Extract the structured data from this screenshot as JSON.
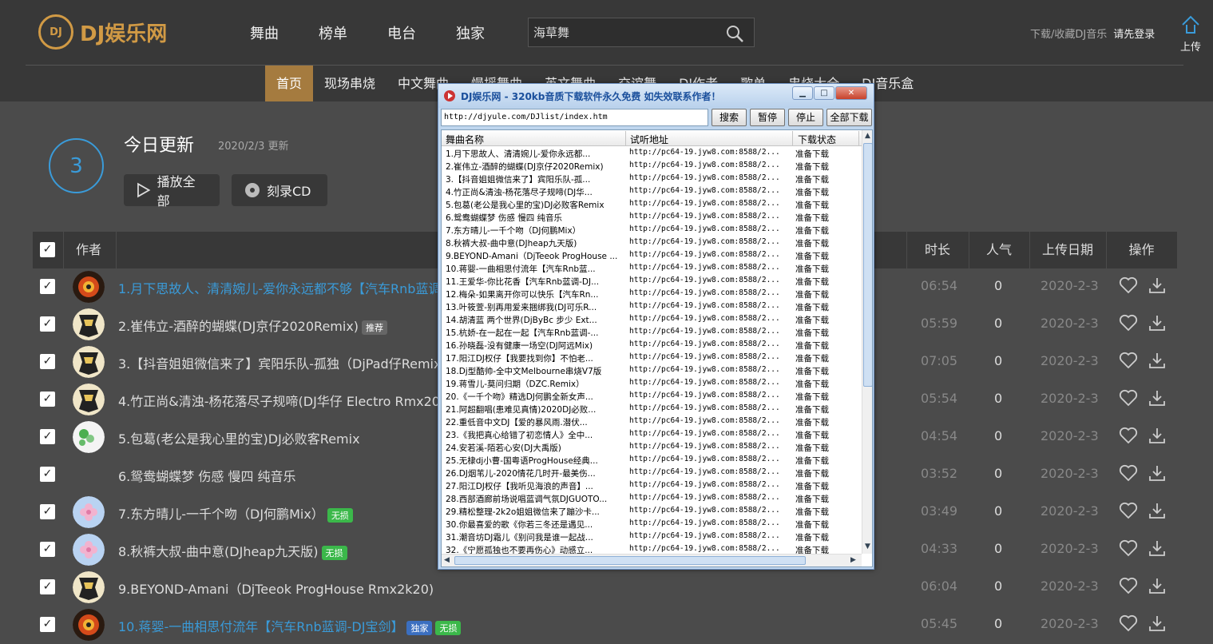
{
  "brand": {
    "logo_mark": "DJ",
    "name": "DJ娱乐网"
  },
  "nav": [
    "舞曲",
    "榜单",
    "电台",
    "独家"
  ],
  "search": {
    "value": "海草舞"
  },
  "top_right": {
    "download_text": "下载/收藏DJ音乐",
    "login": "请先登录",
    "upload": "上传"
  },
  "subnav": [
    "首页",
    "现场串烧",
    "中文舞曲",
    "慢摇舞曲",
    "英文舞曲",
    "交谊舞",
    "DJ作者",
    "歌单",
    "串烧大全",
    "DJ音乐盒"
  ],
  "today": {
    "count": "3",
    "title": "今日更新",
    "date": "2020/2/3 更新",
    "play_all": "播放全部",
    "burn_cd": "刻录CD"
  },
  "table": {
    "headers": {
      "author": "作者",
      "duration": "时长",
      "popularity": "人气",
      "upload_date": "上传日期",
      "action": "操作"
    },
    "rows": [
      {
        "title": "1.月下思故人、清清婉儿-爱你永远都不够【汽车Rnb蓝调",
        "badges": [],
        "duration": "06:54",
        "popularity": "0",
        "date": "2020-2-3",
        "highlight": true,
        "avatar": "fire"
      },
      {
        "title": "2.崔伟立-酒醉的蝴蝶(DJ京仔2020Remix)",
        "badges": [
          {
            "label": "推荐",
            "kind": "rec"
          }
        ],
        "duration": "05:59",
        "popularity": "0",
        "date": "2020-2-3",
        "highlight": false,
        "avatar": "robot"
      },
      {
        "title": "3.【抖音姐姐微信来了】宾阳乐队-孤独（DjPad仔Remix",
        "badges": [],
        "duration": "07:05",
        "popularity": "0",
        "date": "2020-2-3",
        "highlight": false,
        "avatar": "robot"
      },
      {
        "title": "4.竹正尚&清浊-杨花落尽子规啼(DJ华仔 Electro Rmx20",
        "badges": [],
        "duration": "05:54",
        "popularity": "0",
        "date": "2020-2-3",
        "highlight": false,
        "avatar": "robot"
      },
      {
        "title": "5.包葛(老公是我心里的宝)DJ必败客Remix",
        "badges": [],
        "duration": "04:54",
        "popularity": "0",
        "date": "2020-2-3",
        "highlight": false,
        "avatar": "green"
      },
      {
        "title": "6.鸳鸯蝴蝶梦 伤感 慢四 纯音乐",
        "badges": [],
        "duration": "03:52",
        "popularity": "0",
        "date": "2020-2-3",
        "highlight": false,
        "avatar": "none"
      },
      {
        "title": "7.东方晴儿-一千个吻（DJ何鹏Mix）",
        "badges": [
          {
            "label": "无损",
            "kind": "lossless"
          }
        ],
        "duration": "03:49",
        "popularity": "0",
        "date": "2020-2-3",
        "highlight": false,
        "avatar": "flower"
      },
      {
        "title": "8.秋裤大叔-曲中意(DJheap九天版)",
        "badges": [
          {
            "label": "无损",
            "kind": "lossless"
          }
        ],
        "duration": "04:33",
        "popularity": "0",
        "date": "2020-2-3",
        "highlight": false,
        "avatar": "flower"
      },
      {
        "title": "9.BEYOND-Amani（DjTeeok ProgHouse Rmx2k20)",
        "badges": [],
        "duration": "06:04",
        "popularity": "0",
        "date": "2020-2-3",
        "highlight": false,
        "avatar": "robot"
      },
      {
        "title": "10.蒋婴-一曲相思付流年【汽车Rnb蓝调-DJ宝剑】",
        "badges": [
          {
            "label": "独家",
            "kind": "excl"
          },
          {
            "label": "无损",
            "kind": "lossless"
          }
        ],
        "duration": "05:45",
        "popularity": "0",
        "date": "2020-2-3",
        "highlight": true,
        "avatar": "fire"
      }
    ]
  },
  "dialog": {
    "title": "DJ娱乐网 - 320kb音质下载软件永久免费 如失效联系作者！",
    "url": "http://djyule.com/DJlist/index.htm",
    "buttons": {
      "search": "搜索",
      "pause": "暂停",
      "stop": "停止",
      "download_all": "全部下载"
    },
    "columns": {
      "name": "舞曲名称",
      "url": "试听地址",
      "status": "下载状态"
    },
    "items": [
      {
        "name": "1.月下思故人、清清婉儿-爱你永远都...",
        "url": "http://pc64-19.jyw8.com:8588/2...",
        "status": "准备下载"
      },
      {
        "name": "2.崔伟立-酒醉的蝴蝶(DJ京仔2020Remix)",
        "url": "http://pc64-19.jyw8.com:8588/2...",
        "status": "准备下载"
      },
      {
        "name": "3.【抖音姐姐微信来了】宾阳乐队-孤...",
        "url": "http://pc64-19.jyw8.com:8588/2...",
        "status": "准备下载"
      },
      {
        "name": "4.竹正尚&清浊-杨花落尽子规啼(DJ华...",
        "url": "http://pc64-19.jyw8.com:8588/2...",
        "status": "准备下载"
      },
      {
        "name": "5.包葛(老公是我心里的宝)DJ必败客Remix",
        "url": "http://pc64-19.jyw8.com:8588/2...",
        "status": "准备下载"
      },
      {
        "name": "6.鸳鸯蝴蝶梦 伤感 慢四 纯音乐",
        "url": "http://pc64-19.jyw8.com:8588/2...",
        "status": "准备下载"
      },
      {
        "name": "7.东方晴儿-一千个吻（DJ何鹏Mix）",
        "url": "http://pc64-19.jyw8.com:8588/2...",
        "status": "准备下载"
      },
      {
        "name": "8.秋裤大叔-曲中意(DJheap九天版)",
        "url": "http://pc64-19.jyw8.com:8588/2...",
        "status": "准备下载"
      },
      {
        "name": "9.BEYOND-Amani（DjTeeok ProgHouse ...",
        "url": "http://pc64-19.jyw8.com:8588/2...",
        "status": "准备下载"
      },
      {
        "name": "10.蒋婴-一曲相思付流年【汽车Rnb蓝...",
        "url": "http://pc64-19.jyw8.com:8588/2...",
        "status": "准备下载"
      },
      {
        "name": "11.王爱华-你比花香【汽车Rnb蓝调-DJ...",
        "url": "http://pc64-19.jyw8.com:8588/2...",
        "status": "准备下载"
      },
      {
        "name": "12.梅朵-如果离开你可以快乐【汽车Rn...",
        "url": "http://pc64-19.jyw8.com:8588/2...",
        "status": "准备下载"
      },
      {
        "name": "13.叶筱萱-别再用爱来捆绑我(DJ可乐R...",
        "url": "http://pc64-19.jyw8.com:8588/2...",
        "status": "准备下载"
      },
      {
        "name": "14.胡清蓝 两个世界(DjByBc 步少 Ext...",
        "url": "http://pc64-19.jyw8.com:8588/2...",
        "status": "准备下载"
      },
      {
        "name": "15.杭娇-在一起在一起【汽车Rnb蓝调-...",
        "url": "http://pc64-19.jyw8.com:8588/2...",
        "status": "准备下载"
      },
      {
        "name": "16.孙晓磊-没有健康一场空(DJ阿远Mix)",
        "url": "http://pc64-19.jyw8.com:8588/2...",
        "status": "准备下载"
      },
      {
        "name": "17.阳江DJ权仔【我要找到你】不怕老...",
        "url": "http://pc64-19.jyw8.com:8588/2...",
        "status": "准备下载"
      },
      {
        "name": "18.Dj型酷帅-全中文Melbourne串烧V7版",
        "url": "http://pc64-19.jyw8.com:8588/2...",
        "status": "准备下载"
      },
      {
        "name": "19.蒋雪儿-莫问归期（DZC.Remix）",
        "url": "http://pc64-19.jyw8.com:8588/2...",
        "status": "准备下载"
      },
      {
        "name": "20.《一千个吻》精选DJ何鹏全新女声...",
        "url": "http://pc64-19.jyw8.com:8588/2...",
        "status": "准备下载"
      },
      {
        "name": "21.阿超翻唱(患难见真情)2020DJ必败...",
        "url": "http://pc64-19.jyw8.com:8588/2...",
        "status": "准备下载"
      },
      {
        "name": "22.重低音中文DJ【爱的暴风雨.潜伏...",
        "url": "http://pc64-19.jyw8.com:8588/2...",
        "status": "准备下载"
      },
      {
        "name": "23.《我把真心给错了初恋情人》全中...",
        "url": "http://pc64-19.jyw8.com:8588/2...",
        "status": "准备下载"
      },
      {
        "name": "24.安若溪-陌若心安(DJ大禹版)",
        "url": "http://pc64-19.jyw8.com:8588/2...",
        "status": "准备下载"
      },
      {
        "name": "25.无棣dj小曹-国粤语ProgHouse经典...",
        "url": "http://pc64-19.jyw8.com:8588/2...",
        "status": "准备下载"
      },
      {
        "name": "26.DJ烟苇儿-2020情花几时开-最美伤...",
        "url": "http://pc64-19.jyw8.com:8588/2...",
        "status": "准备下载"
      },
      {
        "name": "27.阳江DJ权仔【我听见海浪的声音】...",
        "url": "http://pc64-19.jyw8.com:8588/2...",
        "status": "准备下载"
      },
      {
        "name": "28.西部酒廊前场说唱蓝调气氛DJGUOTO...",
        "url": "http://pc64-19.jyw8.com:8588/2...",
        "status": "准备下载"
      },
      {
        "name": "29.精松整理-2k2o姐姐微信来了蹦沙卡...",
        "url": "http://pc64-19.jyw8.com:8588/2...",
        "status": "准备下载"
      },
      {
        "name": "30.你最喜爱的歌《你若三冬还是遇见...",
        "url": "http://pc64-19.jyw8.com:8588/2...",
        "status": "准备下载"
      },
      {
        "name": "31.潮音坊DJ霜儿《别问我是谁一起战...",
        "url": "http://pc64-19.jyw8.com:8588/2...",
        "status": "准备下载"
      },
      {
        "name": "32.《宁愿孤独也不要再伤心》动感立...",
        "url": "http://pc64-19.jyw8.com:8588/2...",
        "status": "准备下载"
      }
    ]
  },
  "colors": {
    "accent": "#d19a45",
    "link": "#3a9bd9",
    "lossless": "#3bb84a",
    "exclusive": "#3b6fc0",
    "subnav_active": "#a57b3f"
  }
}
